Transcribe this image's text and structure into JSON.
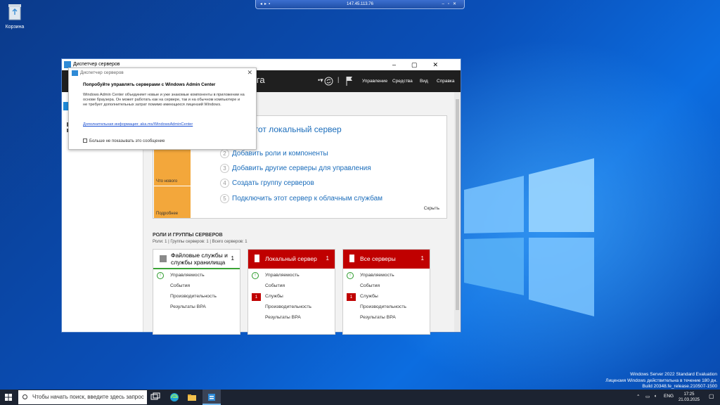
{
  "remote_bar": {
    "address": "147.45.113.76"
  },
  "desktop": {
    "recycle_bin_label": "Корзина",
    "watermark": {
      "line1": "Windows Server 2022 Standard Evaluation",
      "line2": "Лицензия Windows действительна в течение 180 дн.",
      "line3": "Build 20348.fe_release.210507-1500"
    }
  },
  "server_manager": {
    "window_title": "Диспетчер серверов",
    "breadcrumb": "оринга",
    "menu": [
      "Управление",
      "Средства",
      "Вид",
      "Справка"
    ],
    "quick_start": {
      "title": "ить этот локальный сервер",
      "tile_whats_new": "Что нового",
      "tile_learn_more": "Подробнее",
      "steps": [
        {
          "n": "2",
          "label": "Добавить роли и компоненты"
        },
        {
          "n": "3",
          "label": "Добавить другие серверы для управления"
        },
        {
          "n": "4",
          "label": "Создать группу серверов"
        },
        {
          "n": "5",
          "label": "Подключить этот сервер к облачным службам"
        }
      ],
      "hide": "Скрыть"
    },
    "roles": {
      "heading": "РОЛИ И ГРУППЫ СЕРВЕРОВ",
      "summary": "Роли: 1 | Группы серверов: 1 | Всего серверов: 1",
      "cards": [
        {
          "title": "Файловые службы и службы хранилища",
          "count": "1",
          "rows": [
            "Управляемость",
            "События",
            "Производительность",
            "Результаты BPA"
          ]
        },
        {
          "title": "Локальный сервер",
          "count": "1",
          "rows": [
            "Управляемость",
            "События",
            "Службы",
            "Производительность",
            "Результаты BPA"
          ],
          "services_badge": "1"
        },
        {
          "title": "Все серверы",
          "count": "1",
          "rows": [
            "Управляемость",
            "События",
            "Службы",
            "Производительность",
            "Результаты BPA"
          ],
          "services_badge": "1"
        }
      ]
    }
  },
  "dialog": {
    "title": "Диспетчер серверов",
    "heading": "Попробуйте управлять серверами с Windows Admin Center",
    "body": "Windows Admin Center объединяет новые и уже знакомые компоненты в приложении на основе браузера. Он может работать как на сервере, так и на обычном компьютере и не требует дополнительных затрат помимо имеющихся лицензий Windows.",
    "link": "Дополнительная информация: aka.ms/WindowsAdminCenter",
    "checkbox": "Больше не показывать это сообщение"
  },
  "taskbar": {
    "search_placeholder": "Чтобы начать поиск, введите здесь запрос",
    "language": "ENG",
    "time": "17:25",
    "date": "21.03.2025"
  },
  "colors": {
    "accent": "#1b6dbb",
    "alert": "#c00000",
    "tile": "#f3a73b"
  }
}
